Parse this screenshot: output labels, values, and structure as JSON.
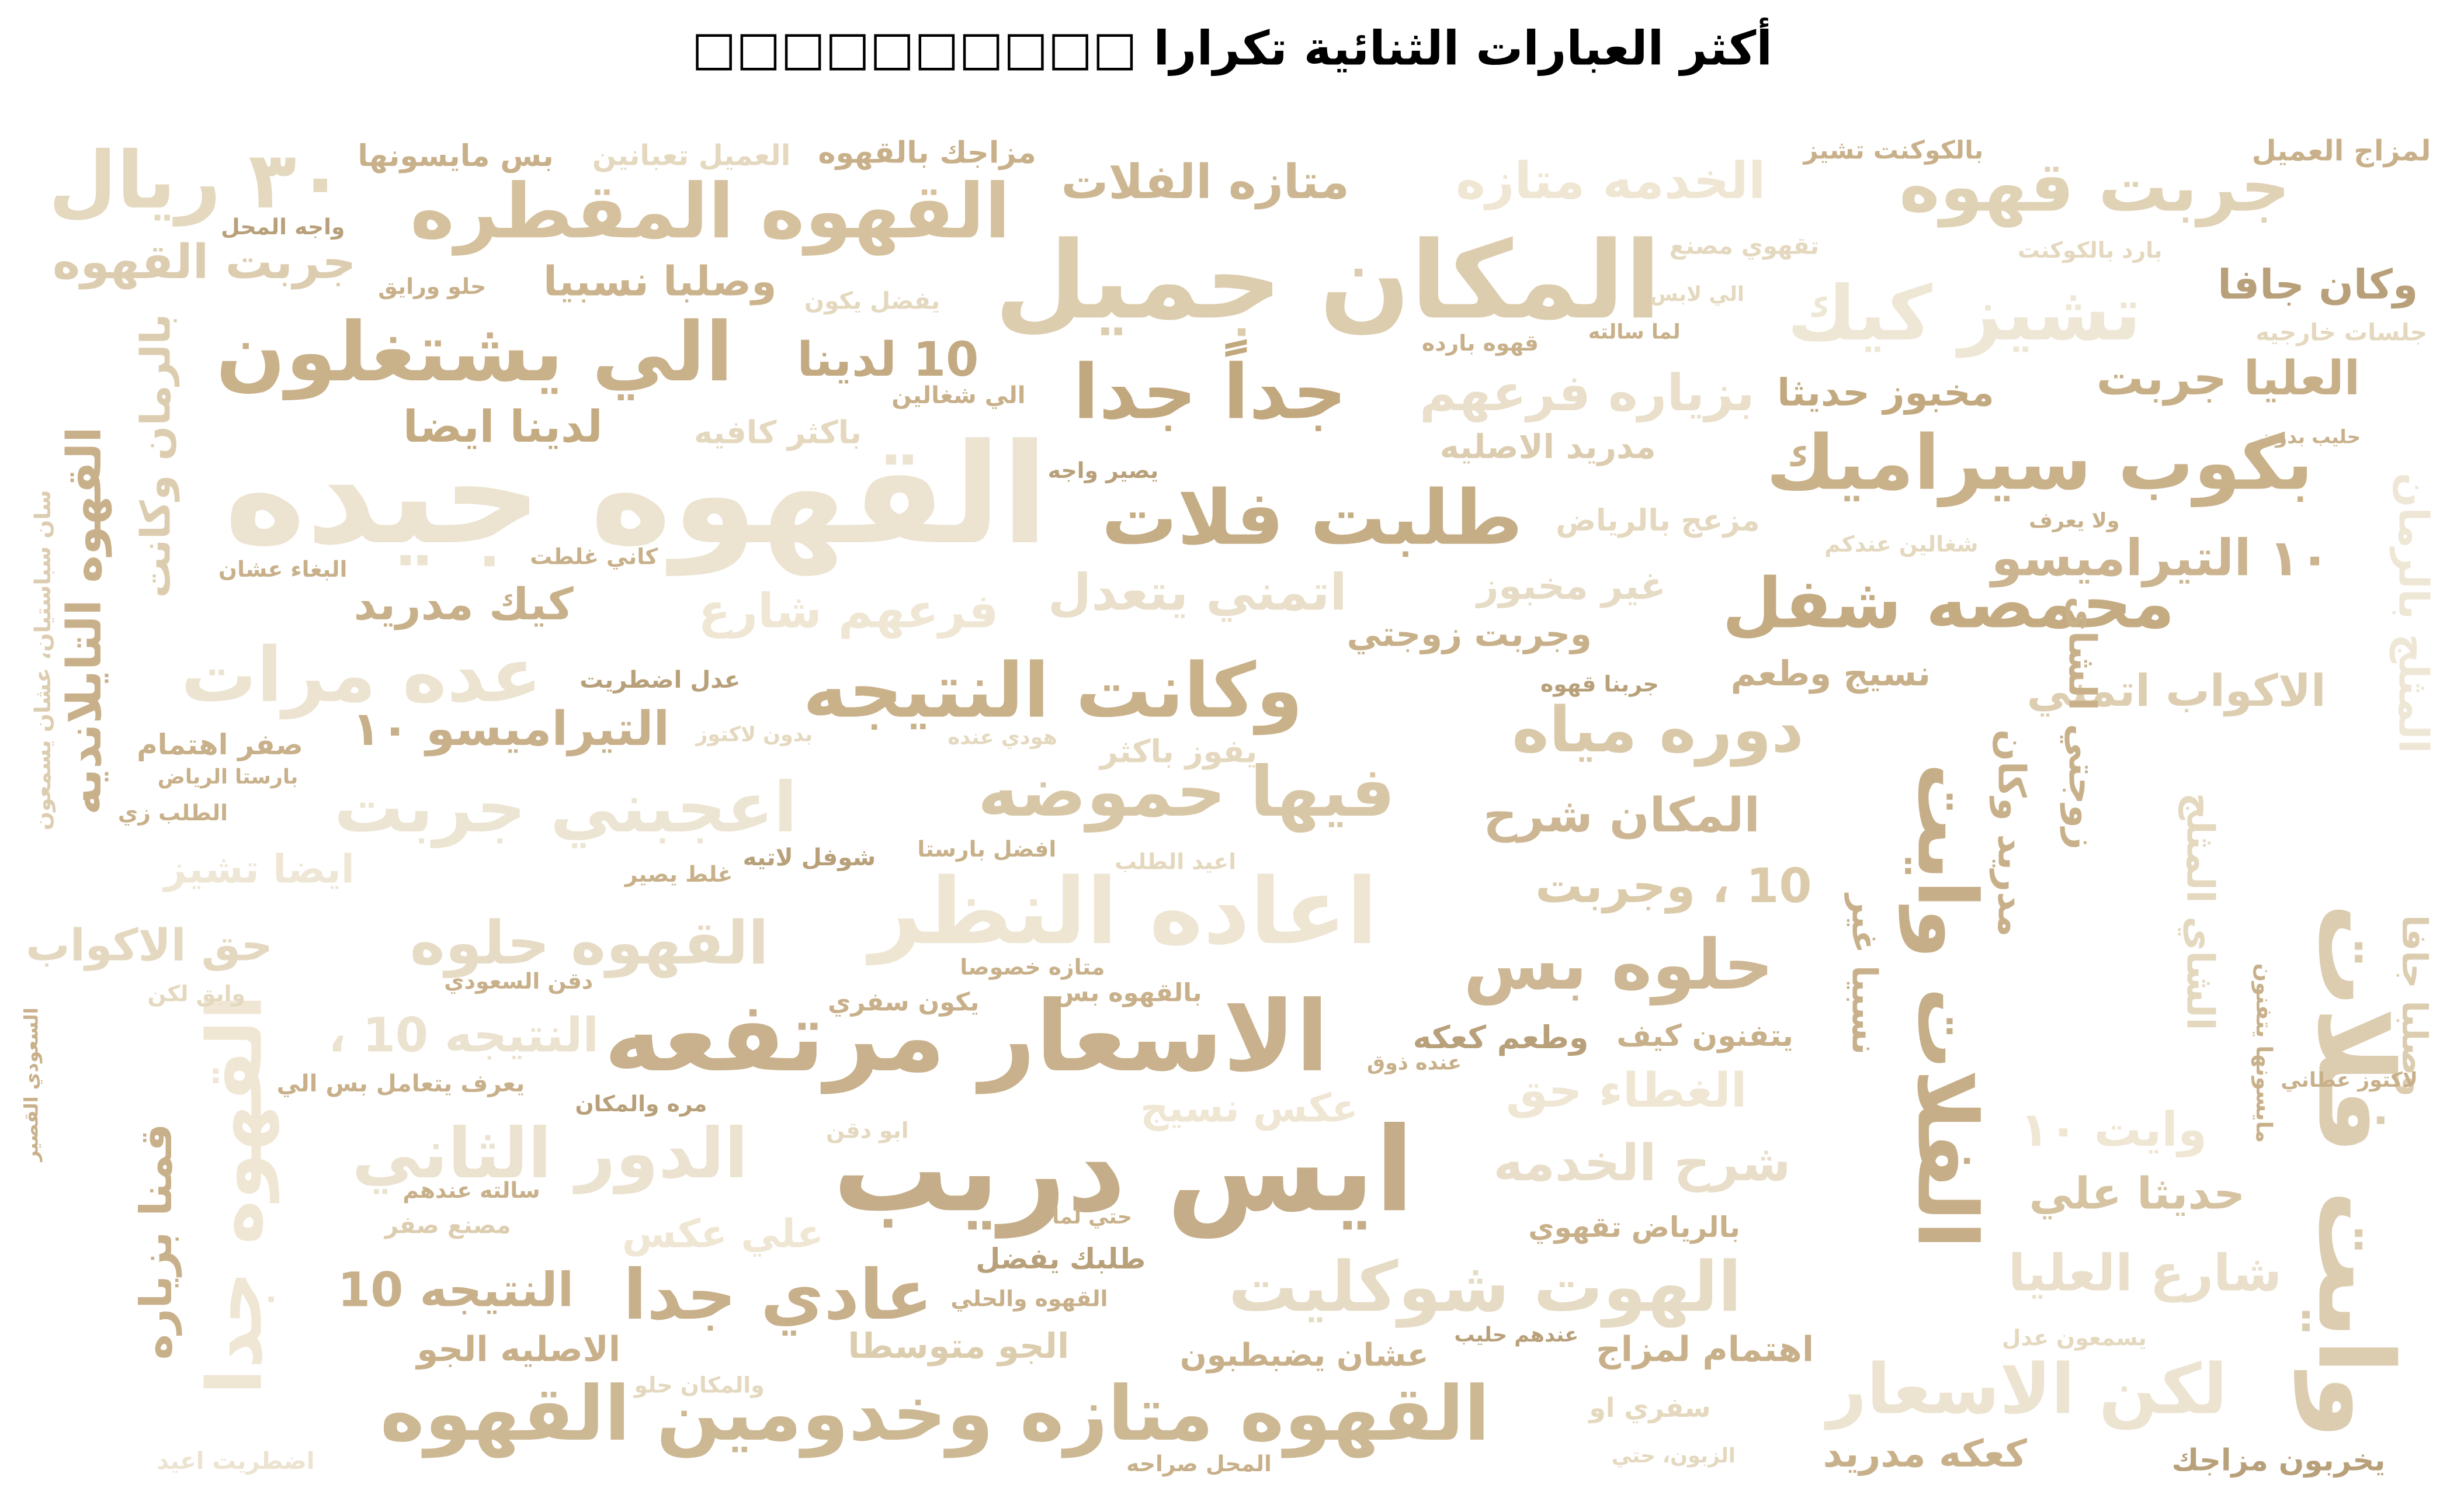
{
  "title": "أكثر العبارات الثنائية تكرارا □□□□□□□□□□",
  "words": [
    "القهوه جيده",
    "المكان جميل",
    "ايس دريب",
    "الاسعار مرتفعه",
    "اعاده النظر",
    "القهوه متازه وخدومين القهوه",
    "القهوه المقطره",
    "الي يشتغلون",
    "جداً جدا",
    "طلبت فلات",
    "بكوب سيراميك",
    "تشيز كيك",
    "جربت قهوه",
    "وايت فلات",
    "الفلات وايت",
    "محمصه شفل",
    "وكانت النتيجه",
    "فيها حموضه",
    "اعجبني جربت",
    "عده مرات",
    "دوره مياه",
    "حلوه بس",
    "الهوت شوكليت",
    "لكن الاسعار",
    "عادي جدا",
    "الدور الثاني",
    "القهوه حلوه",
    "كيك مدريد",
    "التيراميسو ١٠",
    "لدينا ايضا",
    "وصلبا نسبيا",
    "جربت القهوه",
    "٣٠ ريال",
    "متازه الفلات",
    "الخدمه متازه",
    "وكان جافا",
    "العليا جربت",
    "١٠ التيراميسو",
    "الاكواب اتمني",
    "المكان شرح",
    "10 ، وجربت",
    "اتمني يتعدل",
    "وجربت زوجتي",
    "غير مخبوز",
    "مخبوز حديثا",
    "بزياره فرعهم",
    "شرح الخدمه",
    "الغطاء حق",
    "وايت ١٠",
    "حديثا علي",
    "شارع العليا",
    "كعكه مدريد",
    "يخربون مزاجك",
    "النتيجه 10",
    "النتيجه 10 ،",
    "الاصليه الجو",
    "الجو متوسطا",
    "اهتمام لمزاج",
    "عشان يضبطبون",
    "حق الاكواب",
    "ايضا تشيز",
    "10 لدينا",
    "نسيج وطعم",
    "يتفنون كيف",
    "وطعم كعكه",
    "عكس نسيج",
    "علي عكس",
    "مزعج بالرياض",
    "مدريد الاصليه",
    "القهوه التايلانديه",
    "بالرمان وكانت",
    "قمنا بزياره",
    "القهوه جدا",
    "المثلج بالرمان",
    "مدريد وكان",
    "زوجتي الشاي",
    "الشاي المثلج",
    "نسبيا غير",
    "بس مايسونها",
    "العميل تعبانين",
    "مزاجك بالقهوه",
    "بالكوكنت تشيز",
    "لمزاج العميل",
    "فرعهم شارع",
    "باكثر كافيه",
    "يفوز باكثر",
    "افضل بارستا",
    "شوفل لاتيه",
    "صفر اهتمام",
    "عدل اضطريت",
    "بالرياض تقهوي",
    "طلبك يفضل",
    "القهوه والحلي",
    "عندهم حليب",
    "سفري او",
    "حتي لما",
    "ابو دقن",
    "يكون سفري",
    "بالقهوه بس",
    "مره والمكان",
    "يعرف يتعامل بس الي",
    "دقن السعودي",
    "وابق لكن",
    "واجه المحل",
    "حلو ورايق",
    "يفضل يكون",
    "الي شغالين",
    "يصير واجه",
    "كاني غلطت",
    "البغاء عشان",
    "جلسات خارجيه",
    "بارد بالكوكنت",
    "تقهوي مصنع",
    "قهوه بارده",
    "لما سالته",
    "الي لابس",
    "حليب بدون",
    "ولا يعرف",
    "شغالين عندكم",
    "جربنا قهوه",
    "هودي عنده",
    "بدون لاكتوز",
    "اعيد الطلب",
    "متازه خصوصا",
    "الطلب زي",
    "بارستا الرياض",
    "وصلبا جافا",
    "مايسونها يتفنون",
    "سان سباستيان، عشان يسمعون",
    "السعودي القصير",
    "مصنع صفر",
    "سالته عندهم",
    "المحل صراحه",
    "الزبون، حتي",
    "يسمعون عدل",
    "لاكتوز عطاني",
    "عنده ذوق",
    "غلط يصير",
    "والمكان حلو",
    "اضطريت اعيد"
  ],
  "palette": {
    "dark": "#b59b73",
    "mid": "#c9b18b",
    "light": "#ddcdb0",
    "pale": "#ede4d1"
  }
}
